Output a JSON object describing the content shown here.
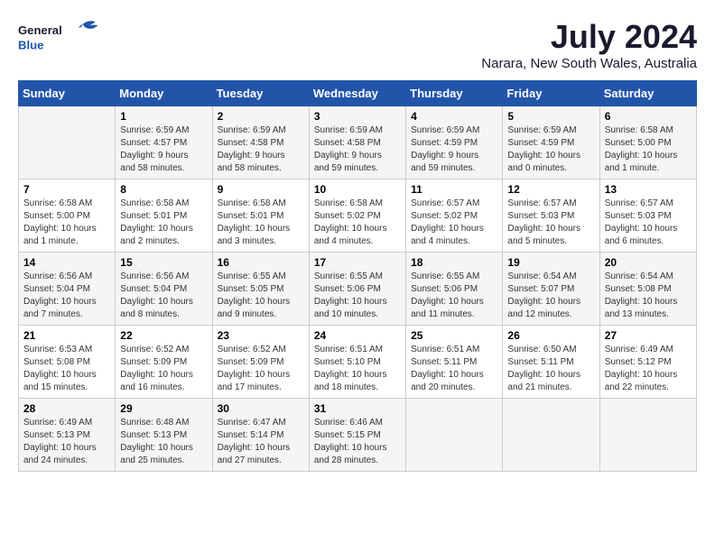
{
  "header": {
    "logo": {
      "general": "General",
      "blue": "Blue"
    },
    "title": "July 2024",
    "location": "Narara, New South Wales, Australia"
  },
  "calendar": {
    "days_of_week": [
      "Sunday",
      "Monday",
      "Tuesday",
      "Wednesday",
      "Thursday",
      "Friday",
      "Saturday"
    ],
    "weeks": [
      {
        "days": [
          {
            "number": "",
            "info": ""
          },
          {
            "number": "1",
            "info": "Sunrise: 6:59 AM\nSunset: 4:57 PM\nDaylight: 9 hours\nand 58 minutes."
          },
          {
            "number": "2",
            "info": "Sunrise: 6:59 AM\nSunset: 4:58 PM\nDaylight: 9 hours\nand 58 minutes."
          },
          {
            "number": "3",
            "info": "Sunrise: 6:59 AM\nSunset: 4:58 PM\nDaylight: 9 hours\nand 59 minutes."
          },
          {
            "number": "4",
            "info": "Sunrise: 6:59 AM\nSunset: 4:59 PM\nDaylight: 9 hours\nand 59 minutes."
          },
          {
            "number": "5",
            "info": "Sunrise: 6:59 AM\nSunset: 4:59 PM\nDaylight: 10 hours\nand 0 minutes."
          },
          {
            "number": "6",
            "info": "Sunrise: 6:58 AM\nSunset: 5:00 PM\nDaylight: 10 hours\nand 1 minute."
          }
        ]
      },
      {
        "days": [
          {
            "number": "7",
            "info": "Sunrise: 6:58 AM\nSunset: 5:00 PM\nDaylight: 10 hours\nand 1 minute."
          },
          {
            "number": "8",
            "info": "Sunrise: 6:58 AM\nSunset: 5:01 PM\nDaylight: 10 hours\nand 2 minutes."
          },
          {
            "number": "9",
            "info": "Sunrise: 6:58 AM\nSunset: 5:01 PM\nDaylight: 10 hours\nand 3 minutes."
          },
          {
            "number": "10",
            "info": "Sunrise: 6:58 AM\nSunset: 5:02 PM\nDaylight: 10 hours\nand 4 minutes."
          },
          {
            "number": "11",
            "info": "Sunrise: 6:57 AM\nSunset: 5:02 PM\nDaylight: 10 hours\nand 4 minutes."
          },
          {
            "number": "12",
            "info": "Sunrise: 6:57 AM\nSunset: 5:03 PM\nDaylight: 10 hours\nand 5 minutes."
          },
          {
            "number": "13",
            "info": "Sunrise: 6:57 AM\nSunset: 5:03 PM\nDaylight: 10 hours\nand 6 minutes."
          }
        ]
      },
      {
        "days": [
          {
            "number": "14",
            "info": "Sunrise: 6:56 AM\nSunset: 5:04 PM\nDaylight: 10 hours\nand 7 minutes."
          },
          {
            "number": "15",
            "info": "Sunrise: 6:56 AM\nSunset: 5:04 PM\nDaylight: 10 hours\nand 8 minutes."
          },
          {
            "number": "16",
            "info": "Sunrise: 6:55 AM\nSunset: 5:05 PM\nDaylight: 10 hours\nand 9 minutes."
          },
          {
            "number": "17",
            "info": "Sunrise: 6:55 AM\nSunset: 5:06 PM\nDaylight: 10 hours\nand 10 minutes."
          },
          {
            "number": "18",
            "info": "Sunrise: 6:55 AM\nSunset: 5:06 PM\nDaylight: 10 hours\nand 11 minutes."
          },
          {
            "number": "19",
            "info": "Sunrise: 6:54 AM\nSunset: 5:07 PM\nDaylight: 10 hours\nand 12 minutes."
          },
          {
            "number": "20",
            "info": "Sunrise: 6:54 AM\nSunset: 5:08 PM\nDaylight: 10 hours\nand 13 minutes."
          }
        ]
      },
      {
        "days": [
          {
            "number": "21",
            "info": "Sunrise: 6:53 AM\nSunset: 5:08 PM\nDaylight: 10 hours\nand 15 minutes."
          },
          {
            "number": "22",
            "info": "Sunrise: 6:52 AM\nSunset: 5:09 PM\nDaylight: 10 hours\nand 16 minutes."
          },
          {
            "number": "23",
            "info": "Sunrise: 6:52 AM\nSunset: 5:09 PM\nDaylight: 10 hours\nand 17 minutes."
          },
          {
            "number": "24",
            "info": "Sunrise: 6:51 AM\nSunset: 5:10 PM\nDaylight: 10 hours\nand 18 minutes."
          },
          {
            "number": "25",
            "info": "Sunrise: 6:51 AM\nSunset: 5:11 PM\nDaylight: 10 hours\nand 20 minutes."
          },
          {
            "number": "26",
            "info": "Sunrise: 6:50 AM\nSunset: 5:11 PM\nDaylight: 10 hours\nand 21 minutes."
          },
          {
            "number": "27",
            "info": "Sunrise: 6:49 AM\nSunset: 5:12 PM\nDaylight: 10 hours\nand 22 minutes."
          }
        ]
      },
      {
        "days": [
          {
            "number": "28",
            "info": "Sunrise: 6:49 AM\nSunset: 5:13 PM\nDaylight: 10 hours\nand 24 minutes."
          },
          {
            "number": "29",
            "info": "Sunrise: 6:48 AM\nSunset: 5:13 PM\nDaylight: 10 hours\nand 25 minutes."
          },
          {
            "number": "30",
            "info": "Sunrise: 6:47 AM\nSunset: 5:14 PM\nDaylight: 10 hours\nand 27 minutes."
          },
          {
            "number": "31",
            "info": "Sunrise: 6:46 AM\nSunset: 5:15 PM\nDaylight: 10 hours\nand 28 minutes."
          },
          {
            "number": "",
            "info": ""
          },
          {
            "number": "",
            "info": ""
          },
          {
            "number": "",
            "info": ""
          }
        ]
      }
    ]
  }
}
